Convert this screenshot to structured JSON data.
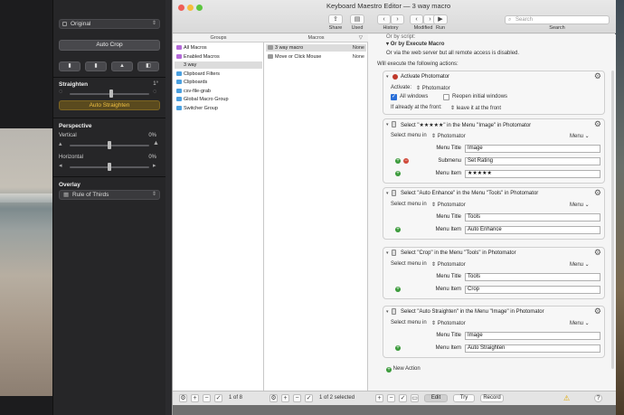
{
  "photomator": {
    "preset_select": "Original",
    "auto_crop_label": "Auto Crop",
    "straighten": {
      "title": "Straighten",
      "value": "1°",
      "button": "Auto Straighten"
    },
    "perspective": {
      "title": "Perspective",
      "vertical_label": "Vertical",
      "vertical_value": "0%",
      "horizontal_label": "Horizontal",
      "horizontal_value": "0%"
    },
    "overlay": {
      "title": "Overlay",
      "value": "Rule of Thirds"
    }
  },
  "km": {
    "window_title": "Keyboard Maestro Editor — 3 way macro",
    "toolbar": {
      "share": "Share",
      "used": "Used",
      "history": "History",
      "modified": "Modified",
      "run": "Run",
      "search_label": "Search",
      "search_placeholder": "Search"
    },
    "groups_header": "Groups",
    "macros_header": "Macros",
    "groups": [
      {
        "name": "All Macros",
        "color": "#b46ad8"
      },
      {
        "name": "Enabled Macros",
        "color": "#b46ad8"
      },
      {
        "name": "3 way",
        "color": ""
      },
      {
        "name": "Clipboard Filters",
        "color": "#4aa0e0"
      },
      {
        "name": "Clipboards",
        "color": "#4aa0e0"
      },
      {
        "name": "csv-file-grab",
        "color": "#4aa0e0"
      },
      {
        "name": "Global Macro Group",
        "color": "#4aa0e0"
      },
      {
        "name": "Switcher Group",
        "color": "#4aa0e0"
      }
    ],
    "macros": [
      {
        "name": "3 way macro",
        "trigger": "None"
      },
      {
        "name": "Move or Click Mouse",
        "trigger": "None"
      }
    ],
    "editor": {
      "by_script_partial": "Or by script:",
      "or_execute": "Or by Execute Macro",
      "web_server_note": "Or via the web server but all remote access is disabled.",
      "will_execute": "Will execute the following actions:",
      "activate": {
        "title": "Activate Photomator",
        "activate_label": "Activate:",
        "activate_value": "Photomator",
        "all_windows": "All windows",
        "reopen": "Reopen initial windows",
        "if_front_label": "If already at the front:",
        "if_front_value": "leave it at the front"
      },
      "actions": [
        {
          "title": "Select \"★★★★★\" in the Menu \"Image\" in Photomator",
          "menu_in_label": "Select menu in",
          "app": "Photomator",
          "menu_dropdown": "Menu",
          "menu_title": "Image",
          "submenu": "Set Rating",
          "menu_item": "★★★★★"
        },
        {
          "title": "Select \"Auto Enhance\" in the Menu \"Tools\" in Photomator",
          "menu_in_label": "Select menu in",
          "app": "Photomator",
          "menu_dropdown": "Menu",
          "menu_title": "Tools",
          "menu_item": "Auto Enhance"
        },
        {
          "title": "Select \"Crop\" in the Menu \"Tools\" in Photomator",
          "menu_in_label": "Select menu in",
          "app": "Photomator",
          "menu_dropdown": "Menu",
          "menu_title": "Tools",
          "menu_item": "Crop"
        },
        {
          "title": "Select \"Auto Straighten\" in the Menu \"Image\" in Photomator",
          "menu_in_label": "Select menu in",
          "app": "Photomator",
          "menu_dropdown": "Menu",
          "menu_title": "Image",
          "menu_item": "Auto Straighten"
        }
      ],
      "labels": {
        "menu_title": "Menu Title",
        "submenu": "Submenu",
        "menu_item": "Menu Item"
      },
      "new_action": "New Action"
    },
    "bottom": {
      "groups_count": "1 of 8",
      "macros_count": "1 of 2 selected",
      "edit": "Edit",
      "try": "Try",
      "record": "Record"
    }
  }
}
